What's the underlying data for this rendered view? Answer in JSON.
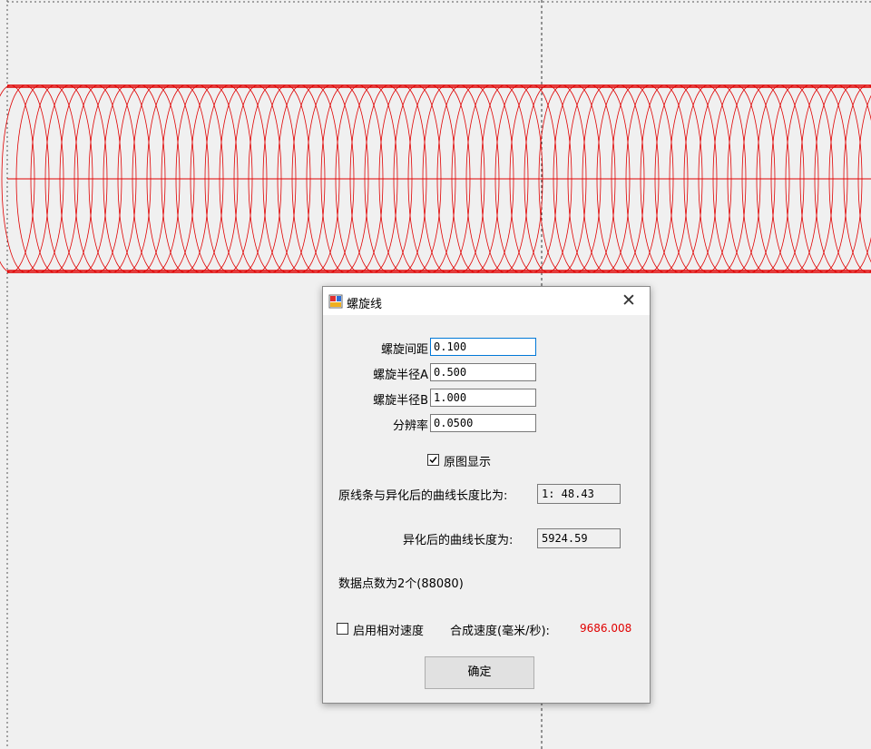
{
  "dialog": {
    "title": "螺旋线",
    "close_glyph": "✕",
    "fields": [
      {
        "label": "螺旋间距",
        "value": "0.100"
      },
      {
        "label": "螺旋半径A",
        "value": "0.500"
      },
      {
        "label": "螺旋半径B",
        "value": "1.000"
      },
      {
        "label": "分辨率",
        "value": "0.0500"
      }
    ],
    "original_display": {
      "label": "原图显示",
      "checked": true
    },
    "ratio": {
      "label": "原线条与异化后的曲线长度比为:",
      "value": "1: 48.43"
    },
    "length": {
      "label": "异化后的曲线长度为:",
      "value": "5924.59"
    },
    "data_points": "数据点数为2个(88080)",
    "relative_speed": {
      "label": "启用相对速度",
      "checked": false
    },
    "combined_speed": {
      "label": "合成速度(毫米/秒):",
      "value": "9686.008"
    },
    "ok_button": "确定"
  },
  "icons": {
    "app": "window-app-icon",
    "close": "close-icon",
    "check": "checkmark-icon"
  },
  "colors": {
    "curve": "#e00000",
    "speed_value": "#e00000",
    "focus_border": "#0078d7"
  }
}
